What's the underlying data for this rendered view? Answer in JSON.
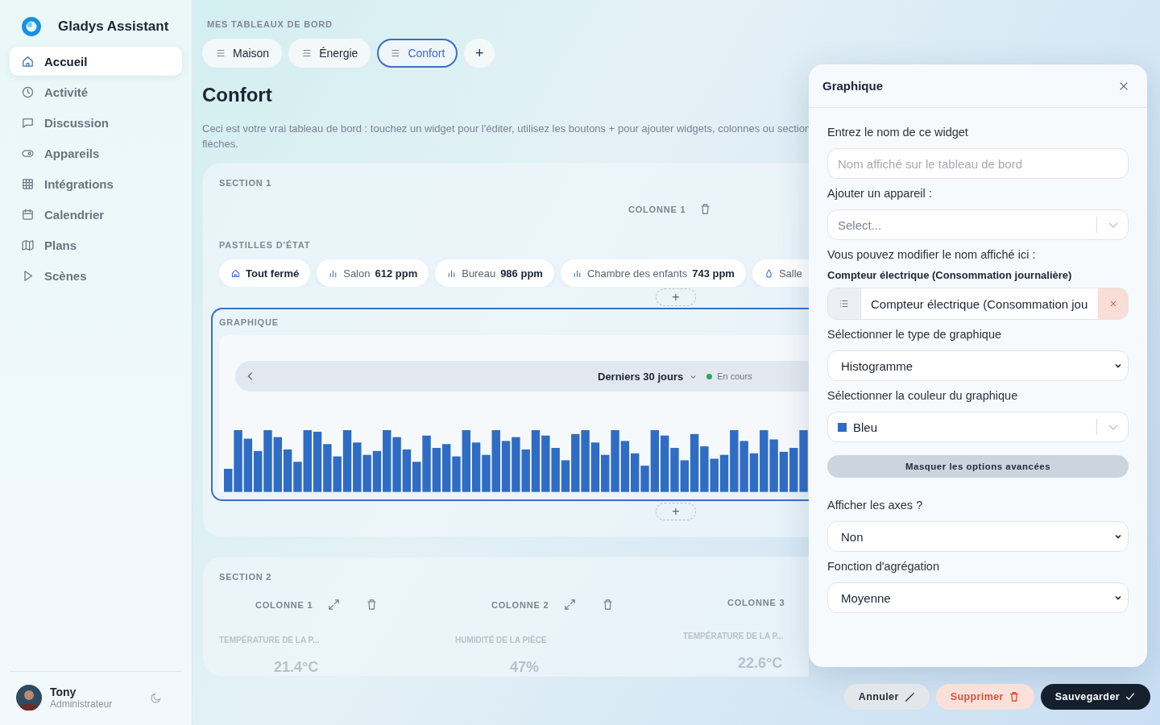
{
  "sidebar": {
    "brand": "Gladys Assistant",
    "items": [
      {
        "label": "Accueil",
        "selected": true
      },
      {
        "label": "Activité",
        "selected": false
      },
      {
        "label": "Discussion",
        "selected": false
      },
      {
        "label": "Appareils",
        "selected": false
      },
      {
        "label": "Intégrations",
        "selected": false
      },
      {
        "label": "Calendrier",
        "selected": false
      },
      {
        "label": "Plans",
        "selected": false
      },
      {
        "label": "Scènes",
        "selected": false
      }
    ],
    "user": {
      "name": "Tony",
      "role": "Administrateur"
    }
  },
  "dashboards": {
    "heading": "MES TABLEAUX DE BORD",
    "tabs": [
      {
        "label": "Maison",
        "selected": false
      },
      {
        "label": "Énergie",
        "selected": false
      },
      {
        "label": "Confort",
        "selected": true
      }
    ],
    "add": "+"
  },
  "title": "Confort",
  "description": [
    "Ceci est votre vrai tableau de bord : touchez un widget pour l'éditer, utilisez les boutons + pour ajouter widgets, colonnes ou section",
    "flèches."
  ],
  "sections": [
    {
      "title": "SECTION 1",
      "columns": [
        "COLONNE 1"
      ],
      "pills_title": "PASTILLES D'ÉTAT",
      "pills": [
        {
          "kind": "state",
          "label": "Tout fermé"
        },
        {
          "kind": "sensor",
          "label": "Salon",
          "value": "612 ppm"
        },
        {
          "kind": "sensor",
          "label": "Bureau",
          "value": "986 ppm"
        },
        {
          "kind": "sensor",
          "label": "Chambre des enfants",
          "value": "743 ppm"
        },
        {
          "kind": "humidity",
          "label": "Salle"
        }
      ],
      "add": "+",
      "chart_widget": {
        "title": "GRAPHIQUE",
        "selected": true,
        "range": "Derniers 30 jours",
        "status": "En cours",
        "add": "+"
      }
    },
    {
      "title": "SECTION 2",
      "columns": [
        "COLONNE 1",
        "COLONNE 2",
        "COLONNE 3"
      ],
      "widgets": [
        {
          "title": "TEMPÉRATURE DE LA P...",
          "value": "21.4°C"
        },
        {
          "title": "HUMIDITÉ DE LA PIÈCE",
          "value": "47%"
        },
        {
          "title": "TEMPÉRATURE DE LA P...",
          "value": "22.6°C"
        }
      ]
    }
  ],
  "modal": {
    "title": "Graphique",
    "name_label": "Entrez le nom de ce widget",
    "name_placeholder": "Nom affiché sur le tableau de bord",
    "device_label": "Ajouter un appareil :",
    "device_placeholder": "Select...",
    "rename_label": "Vous pouvez modifier le nom affiché ici :",
    "device_name": "Compteur électrique (Consommation journalière)",
    "device_value": "Compteur électrique (Consommation jou",
    "type_label": "Sélectionner le type de graphique",
    "type_value": "Histogramme",
    "color_label": "Sélectionner la couleur du graphique",
    "color_value": "Bleu",
    "color": "#2f6cc4",
    "advanced_button": "Masquer les options avancées",
    "axes_label": "Afficher les axes ?",
    "axes_value": "Non",
    "agg_label": "Fonction d'agrégation",
    "agg_value": "Moyenne"
  },
  "actions": [
    {
      "label": "Annuler",
      "kind": "cancel"
    },
    {
      "label": "Supprimer",
      "kind": "delete"
    },
    {
      "label": "Sauvegarder",
      "kind": "save"
    }
  ]
}
